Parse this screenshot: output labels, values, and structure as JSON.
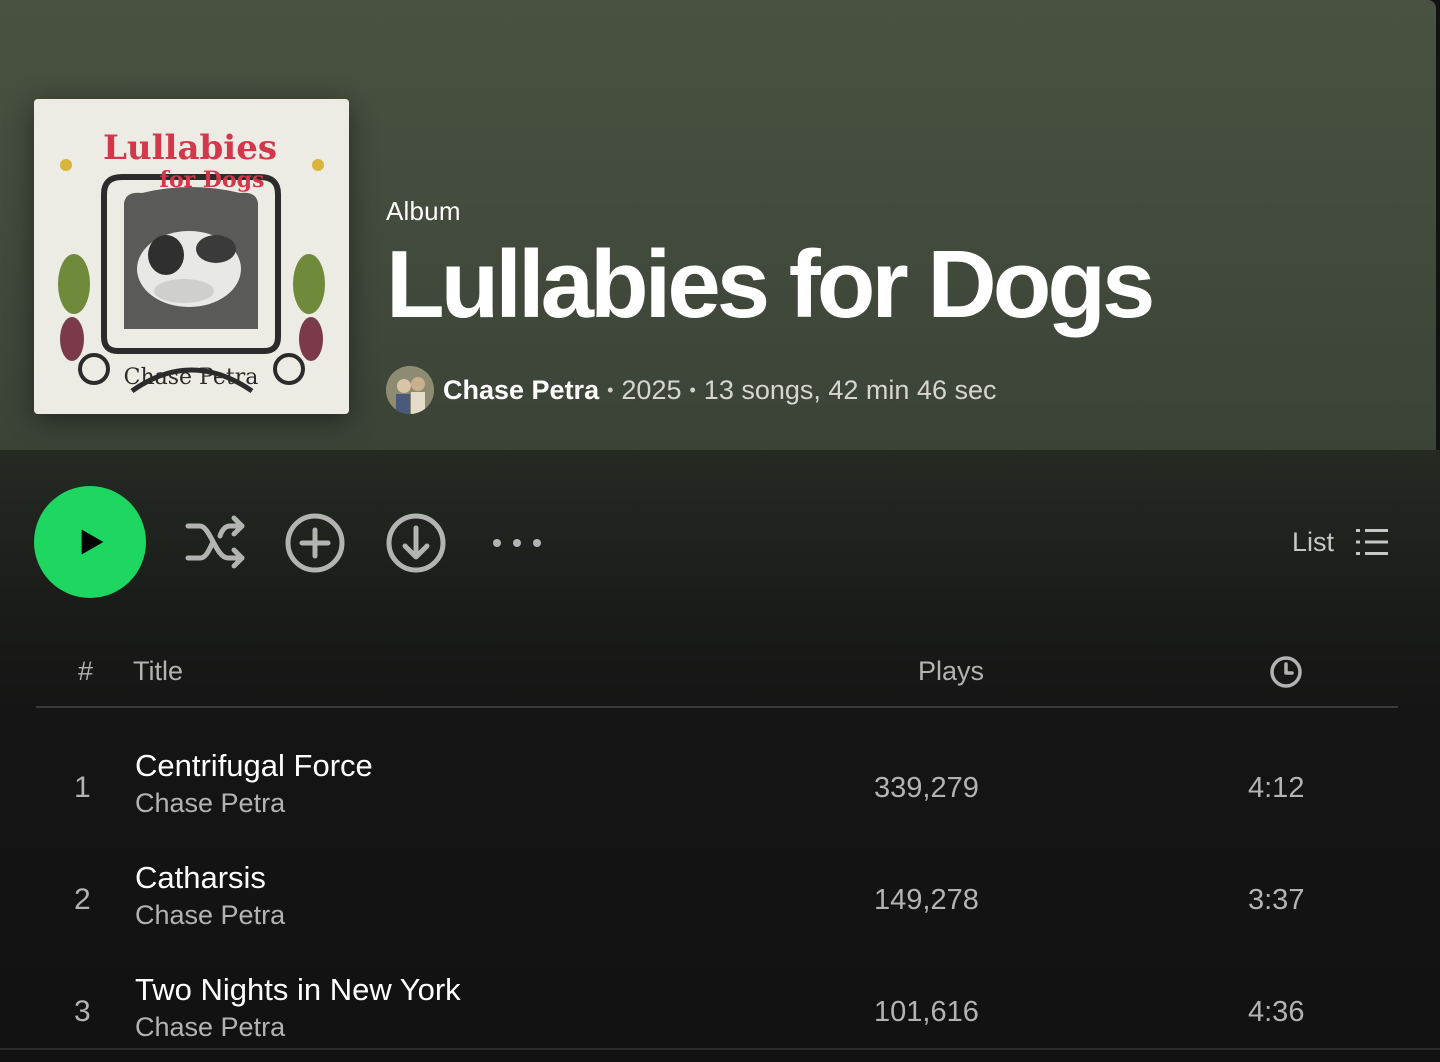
{
  "album": {
    "type_label": "Album",
    "title": "Lullabies for Dogs",
    "artist": "Chase Petra",
    "year": "2025",
    "summary": "13 songs, 42 min 46 sec",
    "separator": "•",
    "cover_text": {
      "title_line1": "Lullabies",
      "title_line2": "for Dogs",
      "artist": "Chase Petra"
    }
  },
  "actions": {
    "play_icon": "play-icon",
    "shuffle_icon": "shuffle-icon",
    "add_icon": "add-circle-icon",
    "download_icon": "download-icon",
    "more_icon": "more-horizontal-icon",
    "view_label": "List",
    "view_icon": "list-view-icon"
  },
  "colors": {
    "accent": "#1ed760",
    "header_bg": "#464e3e",
    "page_bg": "#121212"
  },
  "table": {
    "header": {
      "num": "#",
      "title": "Title",
      "plays": "Plays",
      "duration_icon": "clock-icon"
    },
    "tracks": [
      {
        "num": "1",
        "title": "Centrifugal Force",
        "artist": "Chase Petra",
        "plays": "339,279",
        "duration": "4:12"
      },
      {
        "num": "2",
        "title": "Catharsis",
        "artist": "Chase Petra",
        "plays": "149,278",
        "duration": "3:37"
      },
      {
        "num": "3",
        "title": "Two Nights in New York",
        "artist": "Chase Petra",
        "plays": "101,616",
        "duration": "4:36"
      }
    ]
  }
}
